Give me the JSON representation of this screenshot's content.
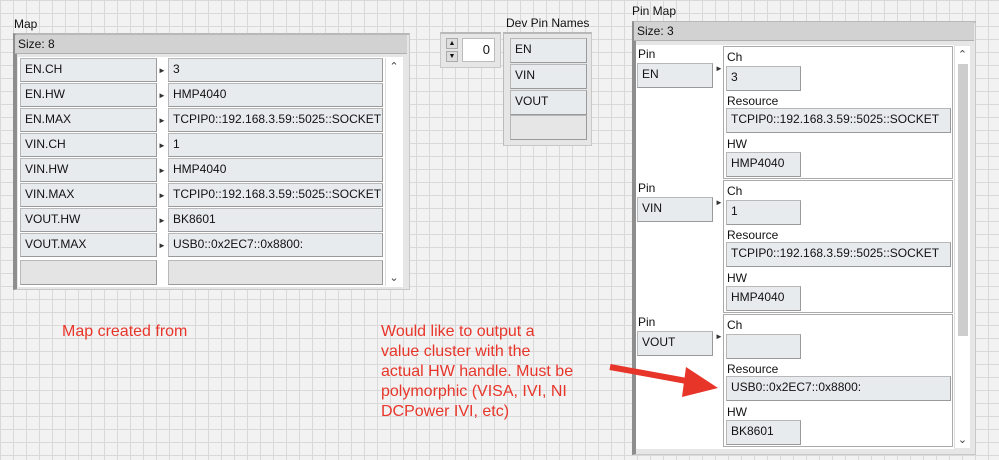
{
  "map": {
    "label": "Map",
    "size": "Size: 8",
    "rows": [
      {
        "key": "EN.CH",
        "value": "3"
      },
      {
        "key": "EN.HW",
        "value": "HMP4040"
      },
      {
        "key": "EN.MAX",
        "value": "TCPIP0::192.168.3.59::5025::SOCKET"
      },
      {
        "key": "VIN.CH",
        "value": "1"
      },
      {
        "key": "VIN.HW",
        "value": "HMP4040"
      },
      {
        "key": "VIN.MAX",
        "value": "TCPIP0::192.168.3.59::5025::SOCKET"
      },
      {
        "key": "VOUT.HW",
        "value": "BK8601"
      },
      {
        "key": "VOUT.MAX",
        "value": "USB0::0x2EC7::0x8800:"
      }
    ]
  },
  "index": {
    "value": "0"
  },
  "dev_pin_names": {
    "label": "Dev Pin Names",
    "items": [
      "EN",
      "VIN",
      "VOUT"
    ]
  },
  "pin_map": {
    "label": "Pin Map",
    "size": "Size: 3",
    "pin_label": "Pin",
    "ch_label": "Ch",
    "resource_label": "Resource",
    "hw_label": "HW",
    "entries": [
      {
        "pin": "EN",
        "ch": "3",
        "resource": "TCPIP0::192.168.3.59::5025::SOCKET",
        "hw": "HMP4040"
      },
      {
        "pin": "VIN",
        "ch": "1",
        "resource": "TCPIP0::192.168.3.59::5025::SOCKET",
        "hw": "HMP4040"
      },
      {
        "pin": "VOUT",
        "ch": "",
        "resource": "USB0::0x2EC7::0x8800:",
        "hw": "BK8601"
      }
    ]
  },
  "annotations": {
    "left": "Map created from",
    "right": [
      "Would like to output a",
      "value cluster with the",
      "actual HW handle. Must be",
      "polymorphic (VISA, IVI, NI",
      "DCPower IVI, etc)"
    ],
    "color": "#e8352a"
  }
}
